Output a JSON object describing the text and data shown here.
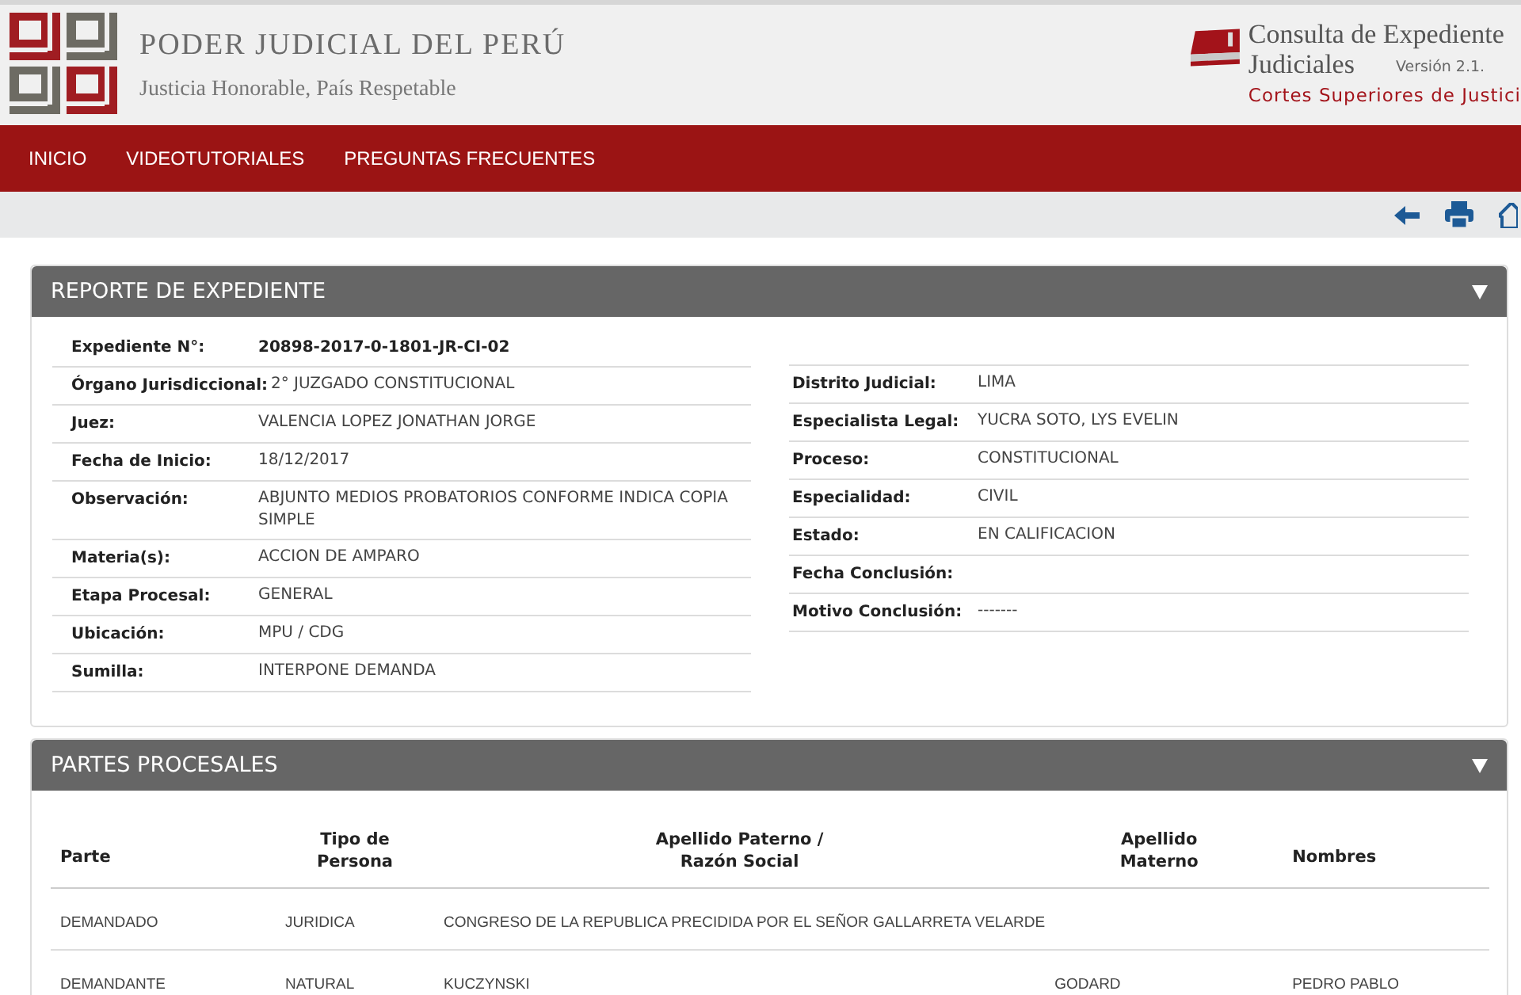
{
  "header": {
    "title": "PODER JUDICIAL DEL PERÚ",
    "subtitle": "Justicia Honorable, País Respetable",
    "app_title_line1": "Consulta de Expediente",
    "app_title_line2": "Judiciales",
    "version": "Versión 2.1.",
    "courts": "Cortes Superiores de Justici"
  },
  "nav": {
    "items": [
      {
        "label": "INICIO"
      },
      {
        "label": "VIDEOTUTORIALES"
      },
      {
        "label": "PREGUNTAS FRECUENTES"
      }
    ]
  },
  "report": {
    "title": "REPORTE DE EXPEDIENTE",
    "expanded": true,
    "case_number": {
      "label": "Expediente N°:",
      "value": "20898-2017-0-1801-JR-CI-02"
    },
    "left_fields": [
      {
        "label": "Órgano Jurisdiccional:",
        "value": "2° JUZGADO CONSTITUCIONAL"
      },
      {
        "label": "Juez:",
        "value": "VALENCIA LOPEZ JONATHAN JORGE"
      },
      {
        "label": "Fecha de Inicio:",
        "value": "18/12/2017"
      },
      {
        "label": "Observación:",
        "value": "ABJUNTO MEDIOS PROBATORIOS CONFORME INDICA COPIA SIMPLE"
      },
      {
        "label": "Materia(s):",
        "value": "ACCION DE AMPARO"
      },
      {
        "label": "Etapa Procesal:",
        "value": "GENERAL"
      },
      {
        "label": "Ubicación:",
        "value": "MPU / CDG"
      },
      {
        "label": "Sumilla:",
        "value": "INTERPONE DEMANDA"
      }
    ],
    "right_fields": [
      {
        "label": "Distrito Judicial:",
        "value": "LIMA"
      },
      {
        "label": "Especialista Legal:",
        "value": "YUCRA SOTO, LYS EVELIN"
      },
      {
        "label": "Proceso:",
        "value": "CONSTITUCIONAL"
      },
      {
        "label": "Especialidad:",
        "value": "CIVIL"
      },
      {
        "label": "Estado:",
        "value": "EN CALIFICACION"
      },
      {
        "label": "Fecha Conclusión:"
      },
      {
        "label": "Motivo Conclusión:",
        "value": "-------"
      }
    ]
  },
  "parties": {
    "title": "PARTES PROCESALES",
    "expanded": true,
    "columns": [
      "Parte",
      "Tipo de Persona",
      "Apellido Paterno / Razón Social",
      "Apellido Materno",
      "Nombres"
    ],
    "rows": [
      [
        "DEMANDADO",
        "JURIDICA",
        "CONGRESO DE LA REPUBLICA PRECIDIDA POR EL SEÑOR GALLARRETA VELARDE",
        "",
        ""
      ],
      [
        "DEMANDANTE",
        "NATURAL",
        "KUCZYNSKI",
        "GODARD",
        "PEDRO PABLO"
      ]
    ]
  }
}
